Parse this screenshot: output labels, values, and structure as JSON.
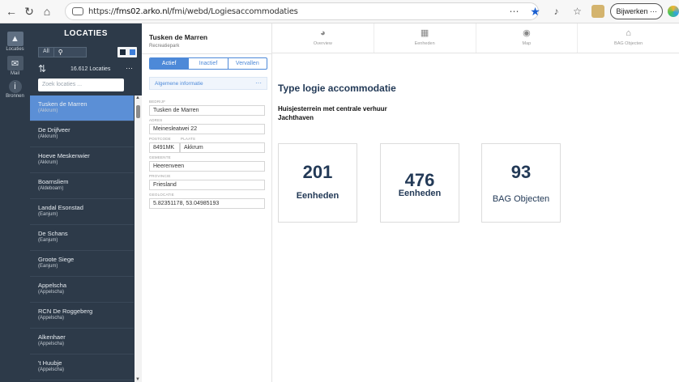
{
  "browser": {
    "url_prefix": "https://",
    "url_host": "fms02.arko.nl",
    "url_path": "/fmi/webd/Logiesaccommodaties",
    "update_label": "Bijwerken",
    "update_more": "···"
  },
  "rail": [
    {
      "label": "Locaties",
      "icon": "hierarchy-icon"
    },
    {
      "label": "Mail",
      "icon": "mail-icon"
    },
    {
      "label": "Bronnen",
      "icon": "info-icon"
    }
  ],
  "sidebar": {
    "title": "LOCATIES",
    "filter_all": "All",
    "count": "16.612 Locaties",
    "more": "···",
    "search_placeholder": "Zoek locaties ...",
    "items": [
      {
        "name": "Tusken de Marren",
        "place": "(Akkrum)"
      },
      {
        "name": "De Drijfveer",
        "place": "(Akkrum)"
      },
      {
        "name": "Hoeve Meskenwier",
        "place": "(Akkrum)"
      },
      {
        "name": "Boarnsliem",
        "place": "(Aldeboarn)"
      },
      {
        "name": "Landal Esonstad",
        "place": "(Eanjum)"
      },
      {
        "name": "De Schans",
        "place": "(Eanjum)"
      },
      {
        "name": "Groote Siege",
        "place": "(Eanjum)"
      },
      {
        "name": "Appelscha",
        "place": "(Appelscha)"
      },
      {
        "name": "RCN De Roggeberg",
        "place": "(Appelscha)"
      },
      {
        "name": "Alkenhaer",
        "place": "(Appelscha)"
      },
      {
        "name": "'t Huubje",
        "place": "(Appelscha)"
      }
    ]
  },
  "detail": {
    "title": "Tusken de Marren",
    "subtitle": "Recreatiepark",
    "tabs": [
      "Actief",
      "Inactief",
      "Vervallen"
    ],
    "section": "Algemene informatie",
    "section_more": "···",
    "labels": {
      "bedrijf": "BEDRIJF",
      "adres": "ADRES",
      "postcode": "POSTCODE",
      "plaats": "PLAATS",
      "gemeente": "GEMEENTE",
      "provincie": "PROVINCIE",
      "geolocatie": "GEOLOCATIE"
    },
    "values": {
      "bedrijf": "Tusken de Marren",
      "adres": "Meinesleatwei 22",
      "postcode": "8491MK",
      "plaats": "Akkrum",
      "gemeente": "Heerenveen",
      "provincie": "Friesland",
      "geolocatie": "5.82351178, 53.04985193"
    }
  },
  "main": {
    "tabs": [
      {
        "label": "Overview",
        "icon": "chart-icon"
      },
      {
        "label": "Eenheden",
        "icon": "grid-icon"
      },
      {
        "label": "Map",
        "icon": "globe-icon"
      },
      {
        "label": "BAG Objecten",
        "icon": "home-icon"
      }
    ],
    "title": "Type logie accommodatie",
    "desc_line1": "Huisjesterrein met centrale verhuur",
    "desc_line2": "Jachthaven",
    "cards": [
      {
        "value": "201",
        "label": "Eenheden"
      },
      {
        "value": "476",
        "label": "Eenheden"
      },
      {
        "value": "93",
        "label": "BAG Objecten"
      }
    ]
  }
}
